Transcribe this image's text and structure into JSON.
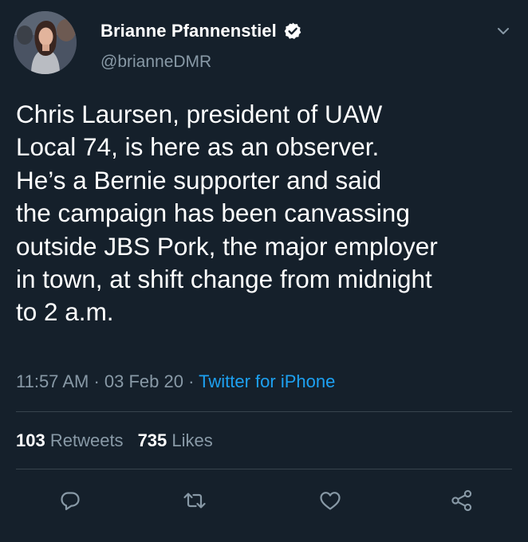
{
  "author": {
    "display_name": "Brianne Pfannenstiel",
    "handle": "@brianneDMR",
    "verified": true
  },
  "tweet": {
    "text": "Chris Laursen, president of UAW\nLocal 74, is here as an observer.\nHe’s a Bernie supporter and said\nthe campaign has been canvassing\noutside JBS Pork, the major employer\nin town, at shift change from midnight\nto 2 a.m.",
    "time": "11:57 AM",
    "date": "03 Feb 20",
    "separator": "·",
    "client": "Twitter for iPhone"
  },
  "stats": {
    "retweets_count": "103",
    "retweets_label": "Retweets",
    "likes_count": "735",
    "likes_label": "Likes"
  },
  "icons": {
    "verified": "verified-badge-icon",
    "caret": "chevron-down-icon",
    "reply": "reply-icon",
    "retweet": "retweet-icon",
    "like": "heart-icon",
    "share": "share-icon"
  },
  "colors": {
    "background": "#15202b",
    "text_primary": "#ffffff",
    "text_secondary": "#8899a6",
    "accent": "#1da1f2",
    "divider": "#38444d"
  }
}
